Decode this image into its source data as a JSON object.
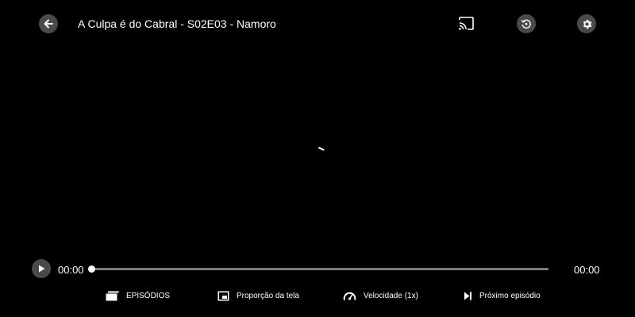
{
  "header": {
    "title": "A Culpa é do Cabral - S02E03 - Namoro",
    "back_icon": "arrow-left-icon",
    "cast_icon": "cast-icon",
    "replay_icon": "replay-icon",
    "settings_icon": "gear-icon"
  },
  "player": {
    "state": "loading",
    "loading_icon": "spinner-icon"
  },
  "progress": {
    "current_time": "00:00",
    "total_time": "00:00",
    "played_fraction": 0,
    "play_icon": "play-icon"
  },
  "actions": [
    {
      "label": "EPISÓDIOS",
      "icon": "episodes-icon"
    },
    {
      "label": "Proporção da tela",
      "icon": "aspect-ratio-icon"
    },
    {
      "label": "Velocidade (1x)",
      "icon": "speedometer-icon"
    },
    {
      "label": "Próximo episódio",
      "icon": "skip-next-icon"
    }
  ],
  "colors": {
    "background": "#000000",
    "control_circle": "#4a4a4a",
    "track": "#7a7a7a",
    "foreground": "#ffffff"
  }
}
